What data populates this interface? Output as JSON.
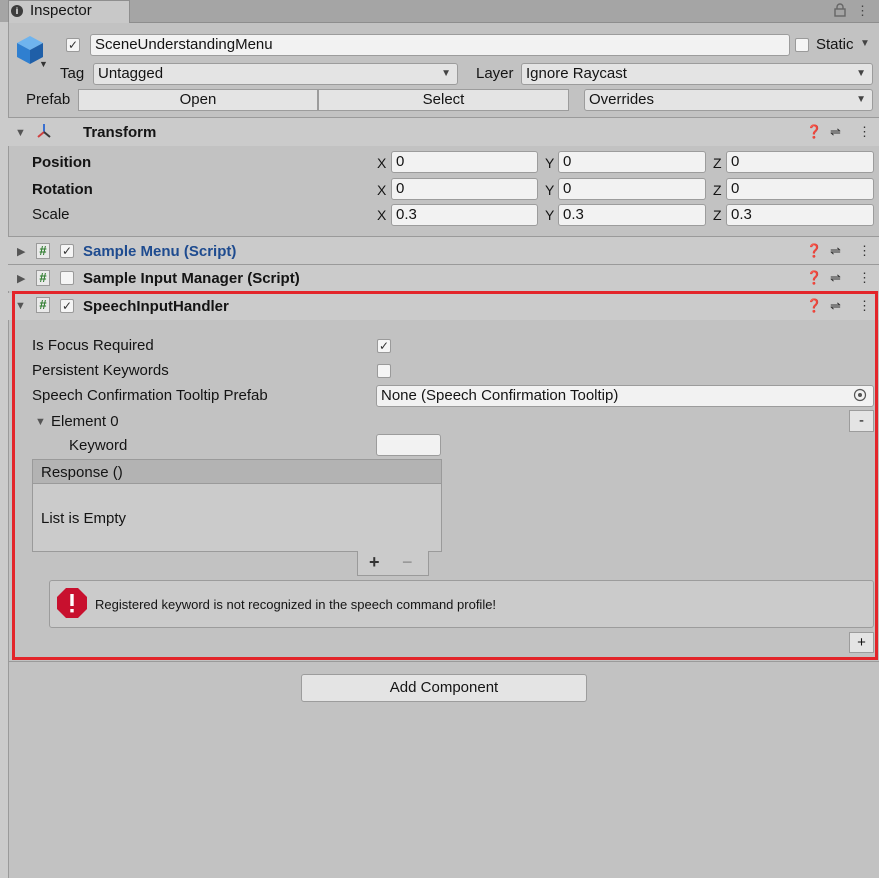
{
  "tab": {
    "title": "Inspector",
    "icon": "info-icon"
  },
  "object": {
    "name": "SceneUnderstandingMenu",
    "active": true,
    "static_label": "Static",
    "static_checked": false,
    "tag_label": "Tag",
    "tag_value": "Untagged",
    "layer_label": "Layer",
    "layer_value": "Ignore Raycast",
    "prefab_label": "Prefab",
    "open_label": "Open",
    "select_label": "Select",
    "overrides_label": "Overrides"
  },
  "transform": {
    "title": "Transform",
    "position_label": "Position",
    "rotation_label": "Rotation",
    "scale_label": "Scale",
    "x": "X",
    "y": "Y",
    "z": "Z",
    "position": [
      "0",
      "0",
      "0"
    ],
    "rotation": [
      "0",
      "0",
      "0"
    ],
    "scale": [
      "0.3",
      "0.3",
      "0.3"
    ]
  },
  "components": {
    "sample_menu": {
      "title": "Sample Menu (Script)",
      "enabled": true
    },
    "sample_input": {
      "title": "Sample Input Manager (Script)",
      "enabled": false
    },
    "speech": {
      "title": "SpeechInputHandler",
      "enabled": true,
      "is_focus_required_label": "Is Focus Required",
      "is_focus_required": true,
      "persistent_keywords_label": "Persistent Keywords",
      "persistent_keywords": false,
      "tooltip_prefab_label": "Speech Confirmation Tooltip Prefab",
      "tooltip_prefab_value": "None (Speech Confirmation Tooltip)",
      "element_label": "Element 0",
      "minus_label": "-",
      "keyword_label": "Keyword",
      "keyword_value": "",
      "response_label": "Response ()",
      "list_empty_label": "List is Empty",
      "plus_label": "+",
      "remove_label": "−",
      "warning_text": "Registered keyword is not recognized in the speech command profile!",
      "add_label": "+"
    }
  },
  "add_component_label": "Add Component",
  "colors": {
    "highlight_border": "#e3252a",
    "script_link": "#1e4b8f",
    "error": "#c8102e"
  }
}
